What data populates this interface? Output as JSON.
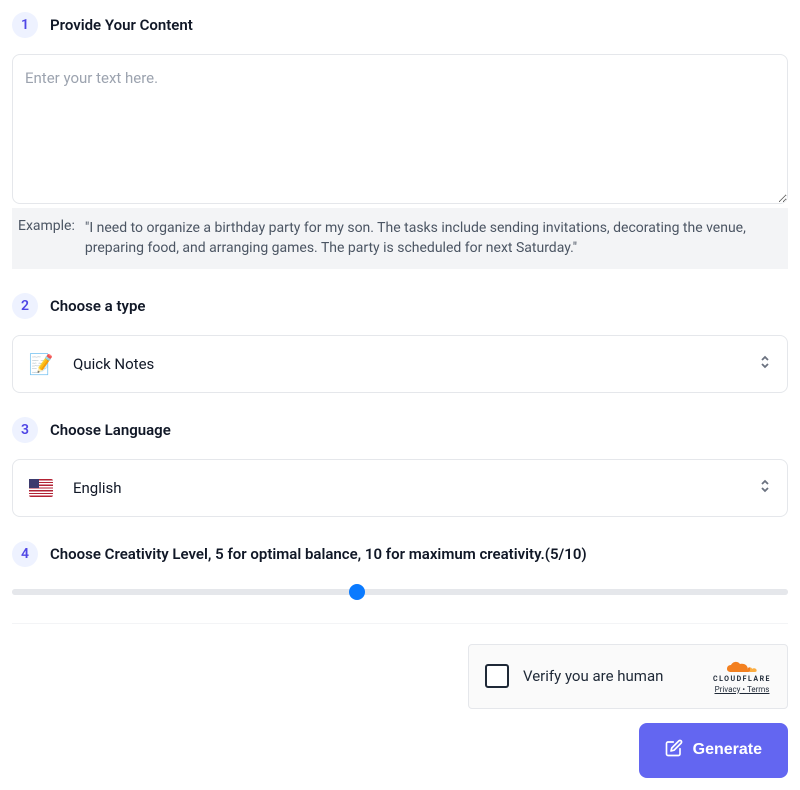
{
  "step1": {
    "number": "1",
    "title": "Provide Your Content",
    "placeholder": "Enter your text here.",
    "example_label": "Example:",
    "example_text": "\"I need to organize a birthday party for my son. The tasks include sending invitations, decorating the venue, preparing food, and arranging games. The party is scheduled for next Saturday.\""
  },
  "step2": {
    "number": "2",
    "title": "Choose a type",
    "selected": "Quick Notes"
  },
  "step3": {
    "number": "3",
    "title": "Choose Language",
    "selected": "English"
  },
  "step4": {
    "number": "4",
    "title": "Choose Creativity Level, 5 for optimal balance, 10 for maximum creativity.(5/10)",
    "value": 5,
    "min": 1,
    "max": 10
  },
  "captcha": {
    "label": "Verify you are human",
    "brand": "CLOUDFLARE",
    "privacy": "Privacy",
    "terms": "Terms"
  },
  "generate_label": "Generate"
}
